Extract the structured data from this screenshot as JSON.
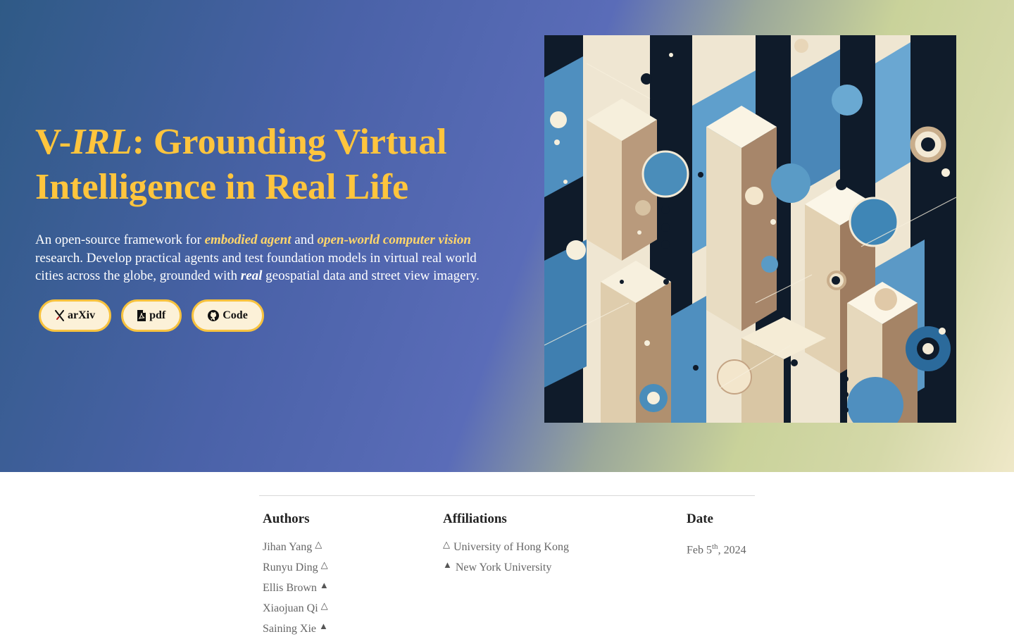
{
  "hero": {
    "title_prefix": "V-",
    "title_italic": "IRL",
    "title_rest": ": Grounding Virtual Intelligence in Real Life",
    "subtitle": {
      "p1": "An open-source framework for ",
      "em1": "embodied agent",
      "p2": " and ",
      "em2": "open-world computer vision",
      "p3": " research. Develop practical agents and test foundation models in virtual real world cities across the globe, grounded with ",
      "em3": "real",
      "p4": " geospatial data and street view imagery."
    },
    "buttons": [
      {
        "label": "arXiv",
        "icon": "arxiv-icon"
      },
      {
        "label": "pdf",
        "icon": "pdf-icon"
      },
      {
        "label": "Code",
        "icon": "github-icon"
      }
    ]
  },
  "info": {
    "authors_heading": "Authors",
    "affiliations_heading": "Affiliations",
    "date_heading": "Date",
    "authors": [
      {
        "name": "Jihan Yang",
        "mark": "△"
      },
      {
        "name": "Runyu Ding",
        "mark": "△"
      },
      {
        "name": "Ellis Brown",
        "mark": "▲"
      },
      {
        "name": "Xiaojuan Qi",
        "mark": "△"
      },
      {
        "name": "Saining Xie",
        "mark": "▲"
      }
    ],
    "affiliations": [
      {
        "mark": "△",
        "name": "University of Hong Kong"
      },
      {
        "mark": "▲",
        "name": "New York University"
      }
    ],
    "date": {
      "month_day": "Feb 5",
      "suffix": "th",
      "year": ", 2024"
    }
  },
  "colors": {
    "accent": "#ffc53d",
    "button_bg": "#fcf1d8",
    "button_border": "#f7c23e"
  }
}
